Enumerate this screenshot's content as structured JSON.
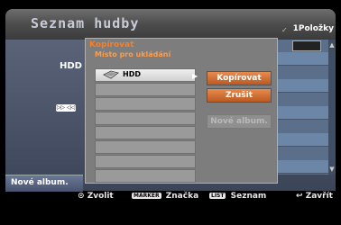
{
  "header": {
    "title": "Seznam hudby",
    "item_count": "1Položky"
  },
  "background": {
    "drive_label": "HDD",
    "new_album_label": "Nové album."
  },
  "dialog": {
    "title": "Kopírovat",
    "subtitle": "Místo pro ukládání",
    "destinations": [
      {
        "label": "HDD",
        "selected": true
      },
      {
        "label": ""
      },
      {
        "label": ""
      },
      {
        "label": ""
      },
      {
        "label": ""
      },
      {
        "label": ""
      },
      {
        "label": ""
      },
      {
        "label": ""
      }
    ],
    "buttons": {
      "copy": "Kopírovat",
      "cancel": "Zrušit",
      "new_album": "Nové album."
    }
  },
  "footer": {
    "select": "Zvolit",
    "marker_key": "MARKER",
    "marker": "Značka",
    "list_key": "LIST",
    "list": "Seznam",
    "close": "Zavřít"
  },
  "colors": {
    "accent_orange": "#ff7d1e",
    "active_button": "#d0763a"
  }
}
